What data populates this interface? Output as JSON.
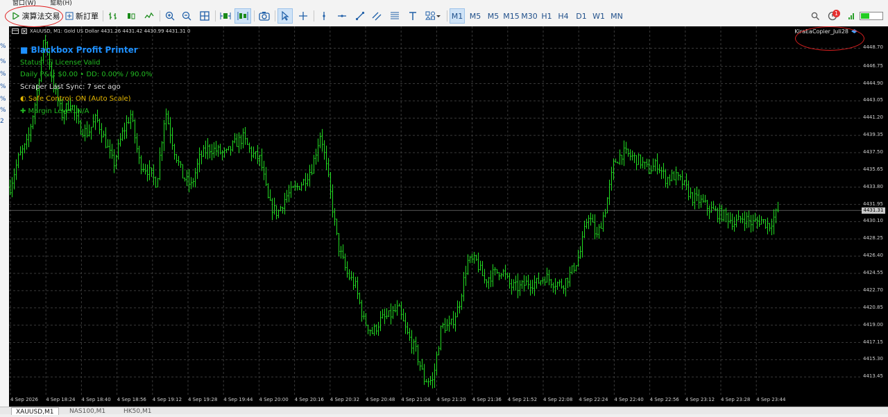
{
  "menubar": {
    "window_menu": "窗口(W)",
    "help_menu": "幫助(H)"
  },
  "toolbar": {
    "algo_trading": "演算法交易",
    "new_order": "新訂單",
    "timeframes": [
      "M1",
      "M5",
      "M15",
      "M30",
      "H1",
      "H4",
      "D1",
      "W1",
      "MN"
    ],
    "active_timeframe": "M1",
    "notification_count": "1"
  },
  "left_strip": [
    "%",
    "%",
    "%",
    "%",
    "%",
    "%",
    "2"
  ],
  "chart": {
    "header": "XAUUSD, M1:  Gold US Dollar  4431.26  4431.42  4430.99  4431.31  0",
    "ea_name": "KiraEaCopier_Juli28",
    "candle_color": "#22dd22",
    "background_color": "#000000",
    "grid_color": "#3a3a3a",
    "current_price": "4431.31"
  },
  "overlay": {
    "title": "■ Blackbox Profit Printer",
    "status": "Status: ☑ License Valid",
    "daily": "Daily P&L: $0.00 • DD: 0.00% / 90.0%",
    "scraper": "Scraper Last Sync: 7 sec ago",
    "safe_control": "◐  Safe Control: ON (Auto Scale)",
    "margin": "✚  Margin Level: N/A"
  },
  "price_axis": [
    "4448.70",
    "4446.75",
    "4444.90",
    "4443.05",
    "4441.20",
    "4439.35",
    "4437.50",
    "4435.65",
    "4433.80",
    "4431.95",
    "4430.10",
    "4428.25",
    "4426.40",
    "4424.55",
    "4422.70",
    "4420.85",
    "4419.00",
    "4417.15",
    "4415.30",
    "4413.45"
  ],
  "time_axis": [
    "4 Sep 2026",
    "4 Sep 18:24",
    "4 Sep 18:40",
    "4 Sep 18:56",
    "4 Sep 19:12",
    "4 Sep 19:28",
    "4 Sep 19:44",
    "4 Sep 20:00",
    "4 Sep 20:16",
    "4 Sep 20:32",
    "4 Sep 20:48",
    "4 Sep 21:04",
    "4 Sep 21:20",
    "4 Sep 21:36",
    "4 Sep 21:52",
    "4 Sep 22:08",
    "4 Sep 22:24",
    "4 Sep 22:40",
    "4 Sep 22:56",
    "4 Sep 23:12",
    "4 Sep 23:28",
    "4 Sep 23:44"
  ],
  "tabs": [
    "XAUUSD,M1",
    "NAS100,M1",
    "HK50,M1"
  ],
  "chart_data": {
    "type": "line",
    "title": "",
    "xlabel": "",
    "ylabel": "",
    "ylim": [
      4412.5,
      4450.0
    ],
    "series": [
      {
        "values": [
          4433.8,
          4437.0,
          4438.5,
          4443.2,
          4450.0,
          4444.9,
          4441.5,
          4443.0,
          4440.2,
          4439.6,
          4441.2,
          4438.8,
          4436.2,
          4439.5,
          4441.6,
          4436.4,
          4435.6,
          4434.2,
          4442.1,
          4437.9,
          4435.0,
          4433.9,
          4437.0,
          4438.0,
          4437.7,
          4437.3,
          4438.4,
          4439.1,
          4437.4,
          4436.8,
          4432.0,
          4431.0,
          4432.8,
          4433.6,
          4434.4,
          4435.9,
          4439.7,
          4434.0,
          4427.6,
          4424.6,
          4423.3,
          4419.5,
          4418.2,
          4419.6,
          4420.0,
          4420.8,
          4418.1,
          4416.3,
          4413.2,
          4413.0,
          4418.9,
          4418.8,
          4421.0,
          4425.8,
          4425.9,
          4423.8,
          4424.5,
          4424.9,
          4423.2,
          4423.0,
          4423.6,
          4423.5,
          4424.2,
          4423.6,
          4423.3,
          4424.6,
          4426.5,
          4431.0,
          4428.4,
          4431.5,
          4436.4,
          4437.5,
          4437.1,
          4436.6,
          4435.6,
          4436.3,
          4434.7,
          4435.0,
          4434.2,
          4432.7,
          4432.3,
          4431.5,
          4431.0,
          4430.7,
          4429.9,
          4430.6,
          4429.9,
          4430.3,
          4429.7,
          4431.3
        ],
        "note_x_range": "4 Sep 18:08 – 4 Sep 23:59, M1"
      }
    ]
  }
}
